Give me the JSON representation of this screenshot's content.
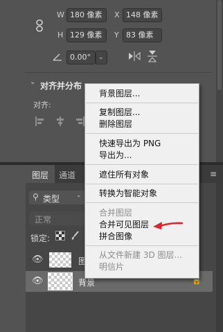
{
  "transform": {
    "w_label": "W",
    "w_value": "180 像素",
    "x_label": "X",
    "x_value": "148 像素",
    "h_label": "H",
    "h_value": "129 像素",
    "y_label": "Y",
    "y_value": "83 像素",
    "angle_value": "0.00°"
  },
  "align": {
    "section_title": "对齐并分布",
    "align_label": "对齐:"
  },
  "layers_panel": {
    "tabs": [
      "图层",
      "通道"
    ],
    "filter_value": "类型",
    "blend_mode": "正常",
    "lock_label": "锁定:",
    "layer_rows": [
      {
        "name": "图"
      },
      {
        "name": "背景"
      }
    ]
  },
  "context_menu": {
    "items": [
      {
        "label": "背景图层...",
        "enabled": true
      },
      {
        "label": "复制图层...",
        "enabled": true
      },
      {
        "label": "删除图层",
        "enabled": true
      },
      {
        "label": "快速导出为 PNG",
        "enabled": true
      },
      {
        "label": "导出为...",
        "enabled": true
      },
      {
        "label": "遮住所有对象",
        "enabled": true
      },
      {
        "label": "转换为智能对象",
        "enabled": true
      },
      {
        "label": "合并图层",
        "enabled": false
      },
      {
        "label": "合并可见图层",
        "enabled": true
      },
      {
        "label": "拼合图像",
        "enabled": true
      },
      {
        "label": "从文件新建 3D 图层...",
        "enabled": false
      },
      {
        "label": "明信片",
        "enabled": false
      }
    ]
  },
  "colors": {
    "annotation_arrow": "#e0242a",
    "panel_bg": "#535353",
    "menu_bg": "#f0f0f0"
  }
}
